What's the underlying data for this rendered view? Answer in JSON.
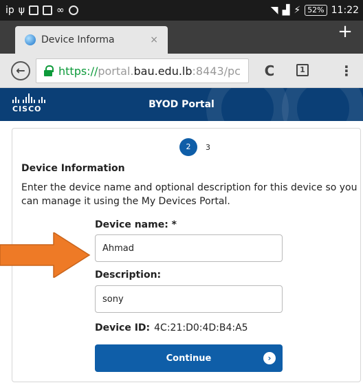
{
  "status_bar": {
    "left_text": "ip",
    "battery": "52%",
    "time": "11:22"
  },
  "tab": {
    "title": "Device Informa",
    "close": "×",
    "new_tab": "+"
  },
  "toolbar": {
    "back": "←",
    "url_proto": "https://",
    "url_pre": "portal.",
    "url_host": "bau.edu.lb",
    "url_post": ":8443/pc",
    "reload": "C",
    "tab_count": "1",
    "menu": "⋮"
  },
  "banner": {
    "logo": "CISCO",
    "title": "BYOD Portal"
  },
  "steps": {
    "current": "2",
    "next": "3"
  },
  "form": {
    "section_title": "Device Information",
    "intro": "Enter the device name and optional description for this device so you can manage it using the My Devices Portal.",
    "device_name_label": "Device name: *",
    "device_name_value": "Ahmad",
    "description_label": "Description:",
    "description_value": "sony",
    "device_id_label": "Device ID:",
    "device_id_value": "4C:21:D0:4D:B4:A5",
    "continue_label": "Continue",
    "continue_chevron": "›"
  },
  "colors": {
    "primary": "#0f5ea8",
    "banner": "#0b3f76",
    "secure": "#0d9a3a",
    "annotation_arrow": "#ee7a26"
  }
}
